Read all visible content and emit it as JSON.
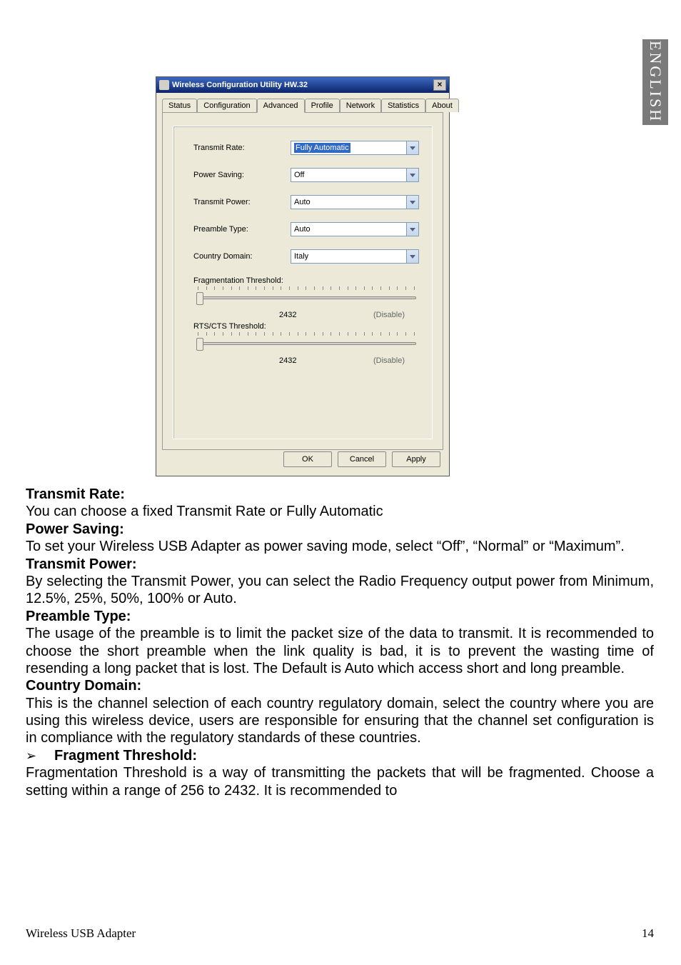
{
  "sideTab": "ENGLISH",
  "dialog": {
    "title": "Wireless Configuration Utility HW.32",
    "tabs": [
      "Status",
      "Configuration",
      "Advanced",
      "Profile",
      "Network",
      "Statistics",
      "About"
    ],
    "activeTab": "Advanced",
    "fields": {
      "transmitRate": {
        "label": "Transmit Rate:",
        "value": "Fully Automatic"
      },
      "powerSaving": {
        "label": "Power Saving:",
        "value": "Off"
      },
      "transmitPower": {
        "label": "Transmit Power:",
        "value": "Auto"
      },
      "preambleType": {
        "label": "Preamble Type:",
        "value": "Auto"
      },
      "countryDomain": {
        "label": "Country Domain:",
        "value": "Italy"
      }
    },
    "sliders": {
      "frag": {
        "label": "Fragmentation Threshold:",
        "value": "2432",
        "status": "(Disable)"
      },
      "rts": {
        "label": "RTS/CTS Threshold:",
        "value": "2432",
        "status": "(Disable)"
      }
    },
    "buttons": {
      "ok": "OK",
      "cancel": "Cancel",
      "apply": "Apply"
    }
  },
  "doc": {
    "h1": "Transmit Rate:",
    "p1": "You can choose a fixed Transmit Rate or Fully Automatic",
    "h2": "Power Saving:",
    "p2": "To set your Wireless USB Adapter as power saving mode, select “Off”, “Normal” or “Maximum”.",
    "h3": "Transmit Power:",
    "p3": "By selecting the Transmit Power, you can select the Radio Frequency output power from Minimum, 12.5%, 25%, 50%, 100% or Auto.",
    "h4": "Preamble Type:",
    "p4": "The usage of the preamble is to limit the packet size of the data to transmit. It is recommended to choose the short preamble when the link quality is bad, it is to prevent the wasting time of resending a long packet that is lost. The Default is Auto which access short and long preamble.",
    "h5": "Country Domain:",
    "p5": "This is the channel selection of each country regulatory domain, select the country where you are using this wireless device, users are responsible for ensuring that the channel set configuration is in compliance with the regulatory standards of these countries.",
    "bullet": "➢",
    "h6": "Fragment Threshold:",
    "p6": "Fragmentation Threshold is a way of transmitting the packets that will be fragmented. Choose a setting within a range of 256 to 2432. It is recommended to"
  },
  "footer": {
    "left": "Wireless USB Adapter",
    "right": "14"
  }
}
